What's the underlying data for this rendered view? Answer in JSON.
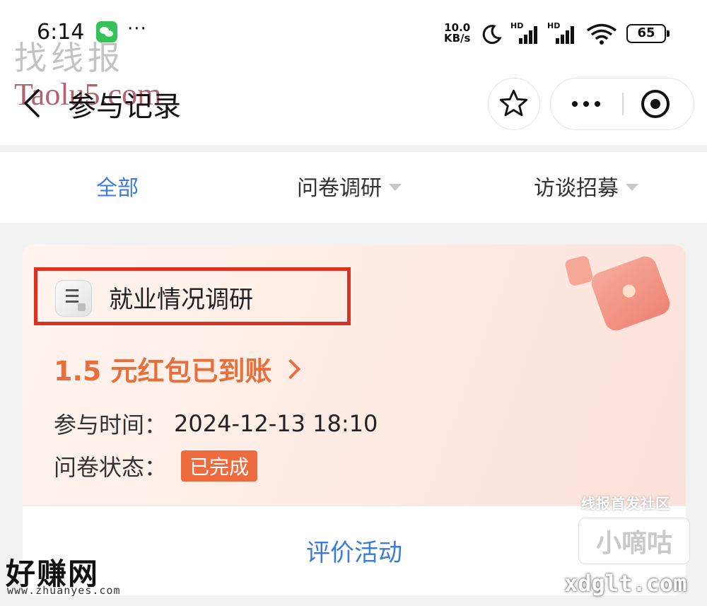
{
  "status_bar": {
    "time": "6:14",
    "dots": "···",
    "net_speed_value": "10.0",
    "net_speed_unit": "KB/s",
    "hd_label": "HD",
    "battery": "65",
    "icons": [
      "wechat-icon",
      "moon-icon",
      "signal-icon",
      "wifi-icon",
      "battery-icon"
    ]
  },
  "watermarks": {
    "top_left_cn": "找线报",
    "top_left_url": "Taolu5.com",
    "forum_label": "线报首发社区",
    "logo_text": "小嘀咕",
    "site_url": "xdglt.com",
    "bottom_left_cn": "好赚网",
    "bottom_left_url": "www.zhuanyes.com"
  },
  "header": {
    "title": "参与记录"
  },
  "tabs": [
    {
      "label": "全部",
      "active": true
    },
    {
      "label": "问卷调研",
      "active": false
    },
    {
      "label": "访谈招募",
      "active": false
    }
  ],
  "card": {
    "title": "就业情况调研",
    "reward_text": "1.5 元红包已到账",
    "time_label": "参与时间：",
    "time_value": "2024-12-13 18:10",
    "status_label": "问卷状态：",
    "status_value": "已完成",
    "evaluate_label": "评价活动"
  },
  "colors": {
    "accent_blue": "#3b7bd9",
    "reward_orange": "#e76f3c",
    "badge_orange": "#ee6b3f",
    "highlight_red": "#d9331f"
  }
}
